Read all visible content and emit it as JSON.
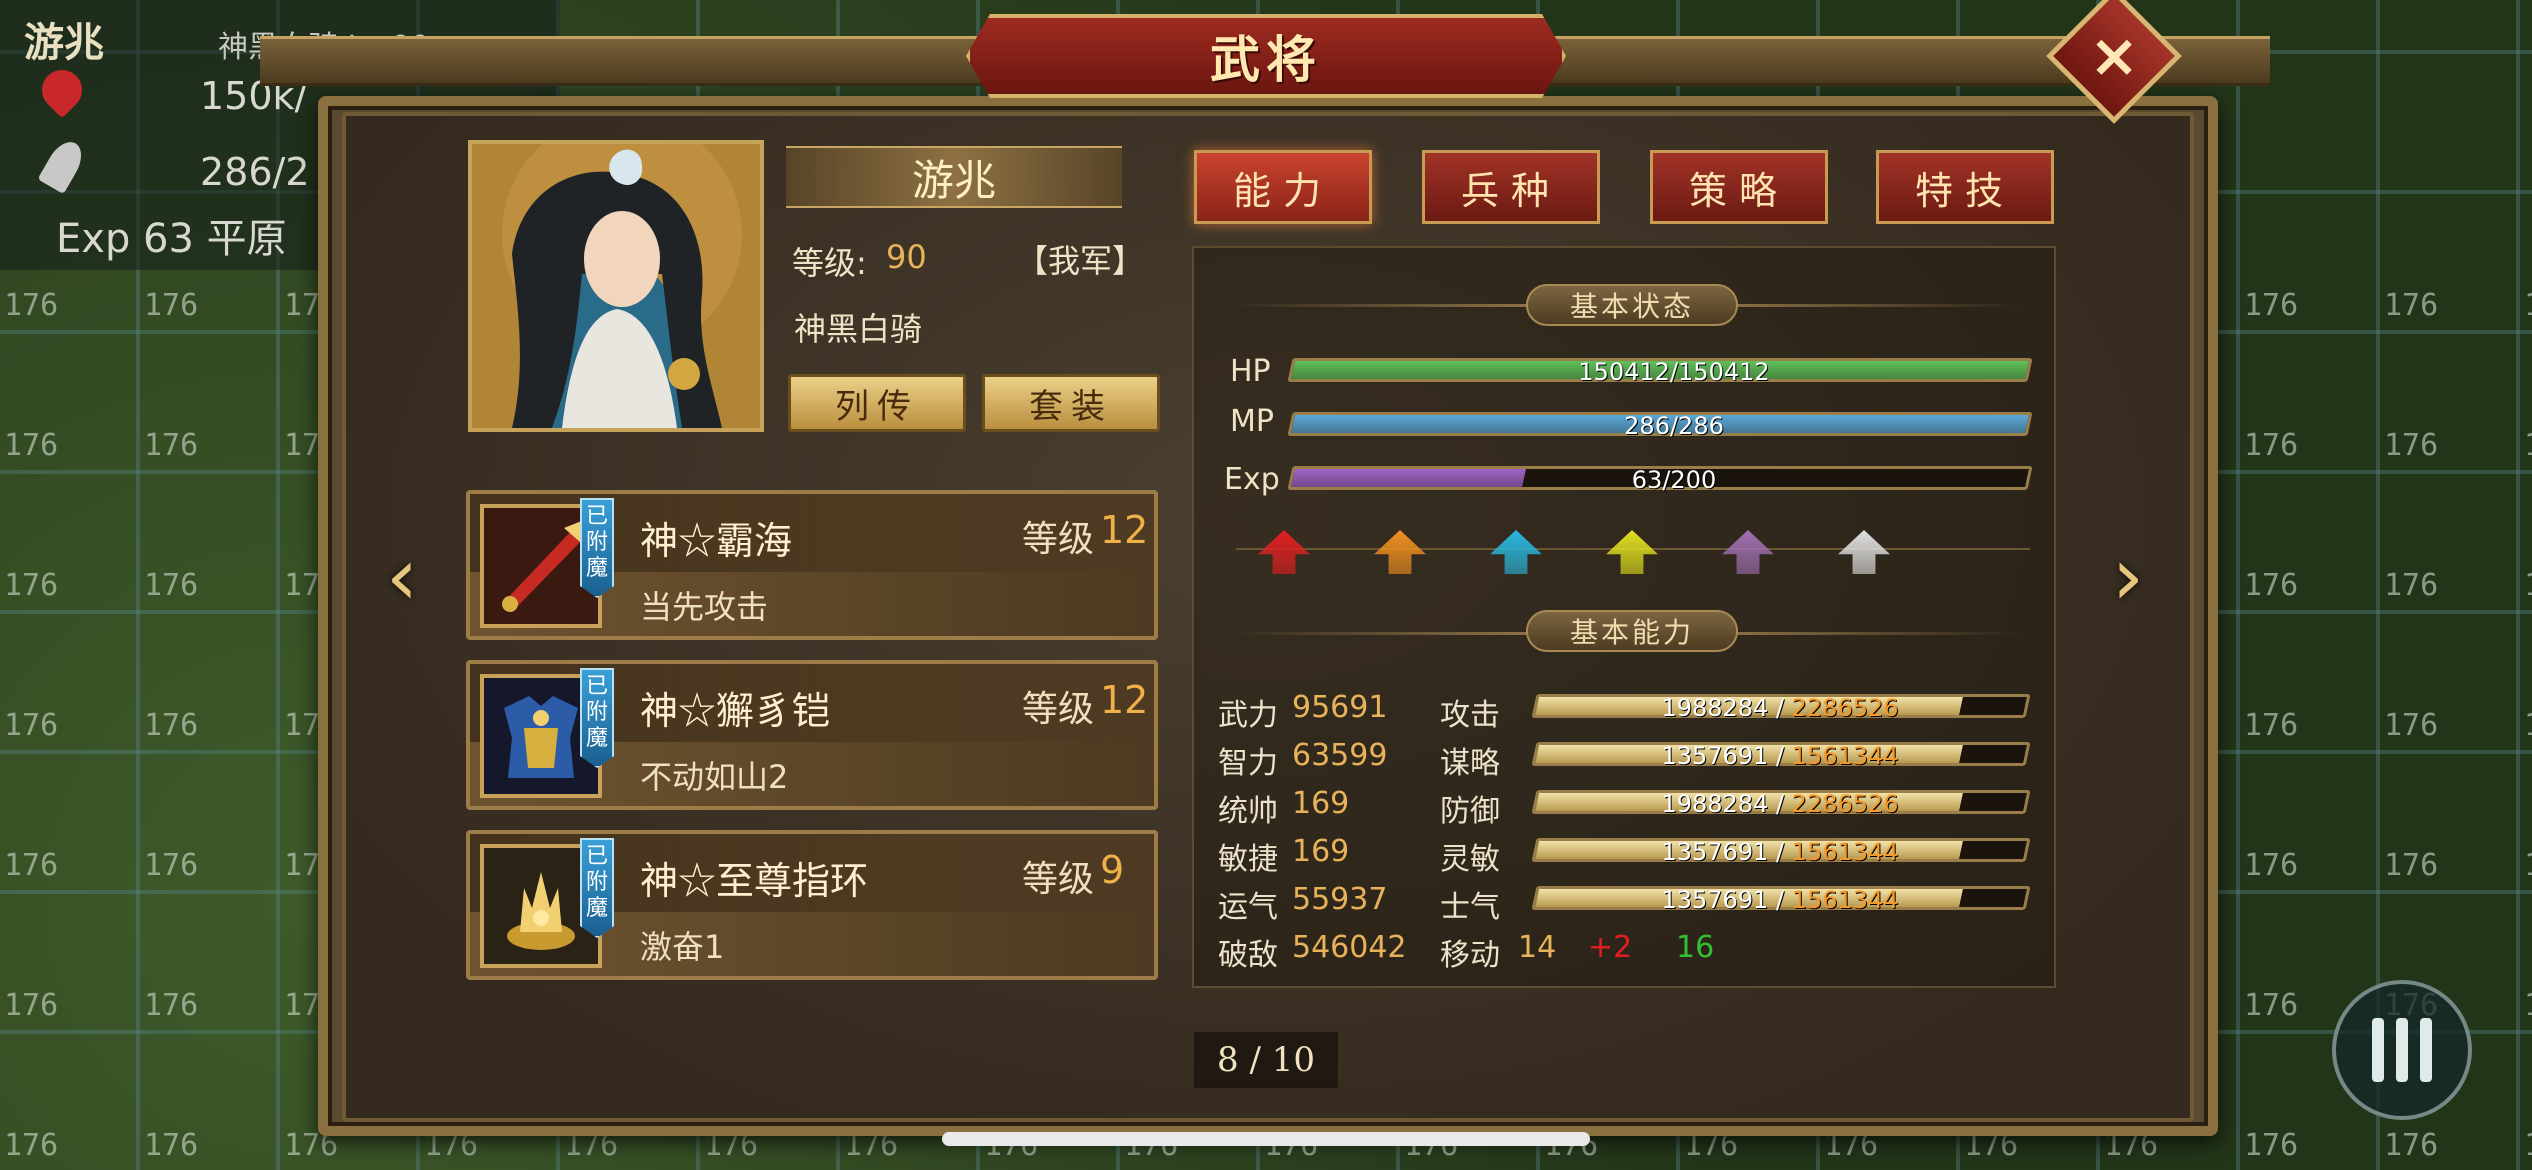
{
  "background": {
    "tile_label": "176",
    "hud": {
      "name": "游兆",
      "unit_line": "神黑白骑 Lv 90",
      "hp_text": "150k/",
      "mp_text": "286/2",
      "exp_line": "Exp 63 平原"
    }
  },
  "panel": {
    "title": "武将",
    "close_icon": "close-icon"
  },
  "general": {
    "name": "游兆",
    "level_label": "等级:",
    "level_value": "90",
    "faction": "【我军】",
    "unit_type": "神黑白骑",
    "biography_button": "列传",
    "equipment_set_button": "套装"
  },
  "tabs": [
    "能力",
    "兵种",
    "策略",
    "特技"
  ],
  "equipment": [
    {
      "name": "神☆霸海",
      "badge": "已附魔",
      "level_label": "等级",
      "level": "12",
      "skill": "当先攻击"
    },
    {
      "name": "神☆獬豸铠",
      "badge": "已附魔",
      "level_label": "等级",
      "level": "12",
      "skill": "不动如山2"
    },
    {
      "name": "神☆至尊指环",
      "badge": "已附魔",
      "level_label": "等级",
      "level": "9",
      "skill": "激奋1"
    }
  ],
  "status": {
    "heading": "基本状态",
    "hp": {
      "label": "HP",
      "text": "150412/150412",
      "current": 150412,
      "max": 150412,
      "color": "#5fbf5a"
    },
    "mp": {
      "label": "MP",
      "text": "286/286",
      "current": 286,
      "max": 286,
      "color": "#5aa8d8"
    },
    "exp": {
      "label": "Exp",
      "text": "63/200",
      "current": 63,
      "max": 200,
      "color": "#a064c8"
    },
    "arrow_colors": [
      "#e02020",
      "#f09020",
      "#2ab8e0",
      "#e0e020",
      "#a070b0",
      "#e0e0e0"
    ]
  },
  "abilities": {
    "heading": "基本能力",
    "stats": [
      {
        "label": "武力",
        "value": "95691"
      },
      {
        "label": "智力",
        "value": "63599"
      },
      {
        "label": "统帅",
        "value": "169"
      },
      {
        "label": "敏捷",
        "value": "169"
      },
      {
        "label": "运气",
        "value": "55937"
      },
      {
        "label": "破敌",
        "value": "546042"
      }
    ],
    "attributes": [
      {
        "label": "攻击",
        "current": "1988284",
        "max": "2286526"
      },
      {
        "label": "谋略",
        "current": "1357691",
        "max": "1561344"
      },
      {
        "label": "防御",
        "current": "1988284",
        "max": "2286526"
      },
      {
        "label": "灵敏",
        "current": "1357691",
        "max": "1561344"
      },
      {
        "label": "士气",
        "current": "1357691",
        "max": "1561344"
      }
    ],
    "separator": " / ",
    "move": {
      "label": "移动",
      "base": "14",
      "bonus": "+2",
      "total": "16"
    }
  },
  "pager": {
    "text": "8 / 10"
  },
  "colors": {
    "accent_gold": "#e8b25a",
    "bonus_red": "#e02020",
    "total_green": "#30c030",
    "max_orange": "#f59a2a"
  }
}
